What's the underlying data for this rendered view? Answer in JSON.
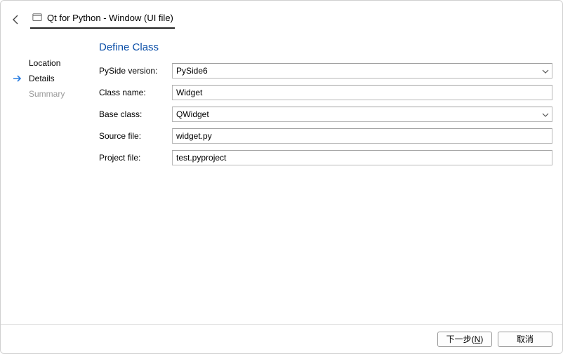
{
  "header": {
    "title": "Qt for Python - Window (UI file)"
  },
  "sidebar": {
    "items": [
      {
        "label": "Location"
      },
      {
        "label": "Details"
      },
      {
        "label": "Summary"
      }
    ]
  },
  "main": {
    "section_title": "Define Class",
    "labels": {
      "pyside_version": "PySide version:",
      "class_name": "Class name:",
      "base_class": "Base class:",
      "source_file": "Source file:",
      "project_file": "Project file:"
    },
    "values": {
      "pyside_version": "PySide6",
      "class_name": "Widget",
      "base_class": "QWidget",
      "source_file": "widget.py",
      "project_file": "test.pyproject"
    }
  },
  "footer": {
    "next_prefix": "下一步(",
    "next_mnemonic": "N",
    "next_suffix": ")",
    "cancel": "取消"
  }
}
